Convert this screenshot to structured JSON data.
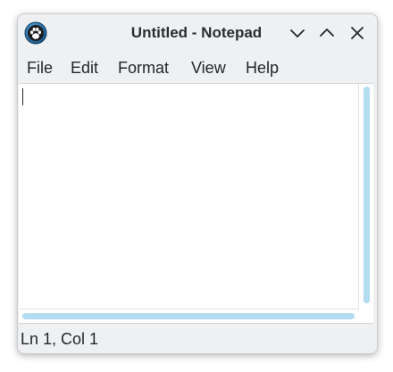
{
  "window": {
    "title": "Untitled - Notepad"
  },
  "icons": {
    "app": "paw-icon",
    "minimize": "chevron-down-icon",
    "maximize": "chevron-up-icon",
    "close": "close-icon"
  },
  "menu": {
    "items": [
      {
        "label": "File"
      },
      {
        "label": "Edit"
      },
      {
        "label": "Format"
      },
      {
        "label": "View"
      },
      {
        "label": "Help"
      }
    ]
  },
  "editor": {
    "content": ""
  },
  "status": {
    "position": "Ln 1, Col 1"
  },
  "colors": {
    "window_bg": "#eff0f1",
    "scrollbar_thumb": "#b2dcf0",
    "icon_bg": "#1d6fa5"
  }
}
